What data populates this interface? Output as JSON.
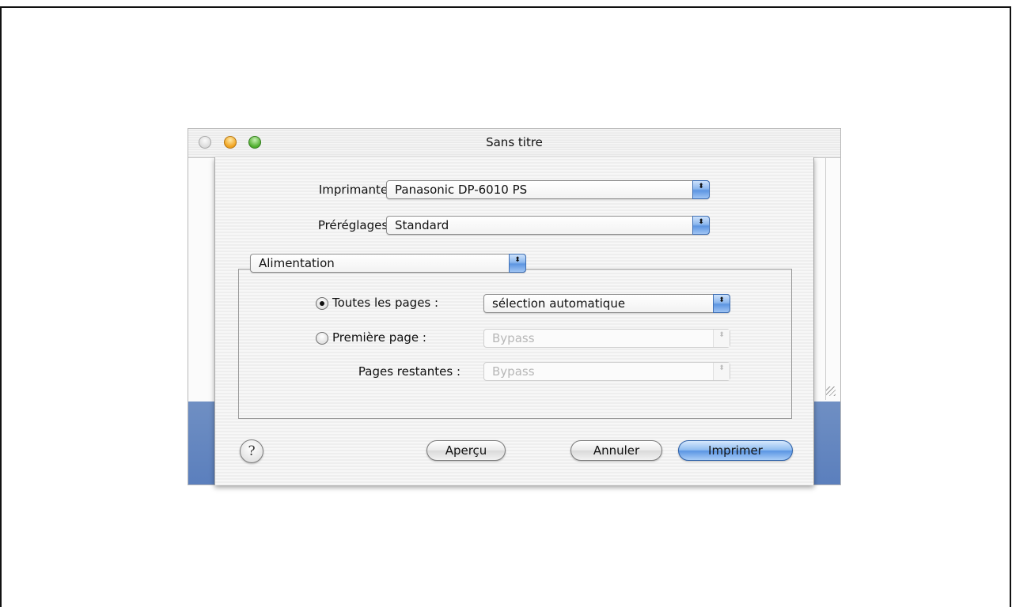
{
  "window": {
    "title": "Sans titre"
  },
  "print_dialog": {
    "printer": {
      "label": "Imprimante :",
      "value": "Panasonic DP-6010 PS"
    },
    "presets": {
      "label": "Préréglages :",
      "value": "Standard"
    },
    "panel_menu": {
      "value": "Alimentation"
    },
    "paper_feed": {
      "all_pages": {
        "label": "Toutes les pages :",
        "value": "sélection automatique",
        "selected": true
      },
      "first_page": {
        "label": "Première page :",
        "value": "Bypass",
        "selected": false
      },
      "remaining_pages": {
        "label": "Pages restantes :",
        "value": "Bypass"
      }
    },
    "buttons": {
      "help": "?",
      "preview": "Aperçu",
      "cancel": "Annuler",
      "print": "Imprimer"
    }
  },
  "icons": {
    "popup_arrows": "⬍"
  }
}
